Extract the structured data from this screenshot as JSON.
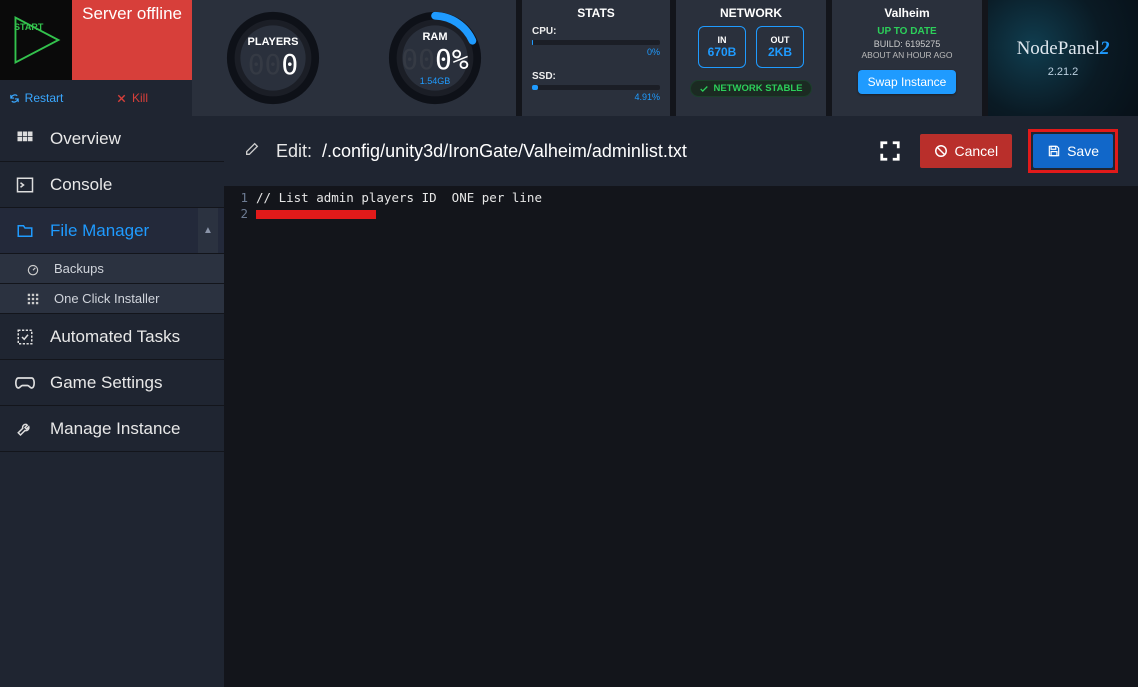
{
  "start": {
    "label": "START"
  },
  "status": {
    "banner": "Server offline",
    "restart": "Restart",
    "kill": "Kill"
  },
  "gauges": {
    "players": {
      "title": "PLAYERS",
      "value": "0",
      "ghost": "00"
    },
    "ram": {
      "title": "RAM",
      "value": "0%",
      "sub": "1.54GB",
      "fill_deg": 55
    }
  },
  "stats": {
    "header": "STATS",
    "cpu": {
      "label": "CPU:",
      "value": "0%",
      "pct": 1
    },
    "ssd": {
      "label": "SSD:",
      "value": "4.91%",
      "pct": 5
    }
  },
  "network": {
    "header": "NETWORK",
    "in": {
      "label": "IN",
      "value": "670B"
    },
    "out": {
      "label": "OUT",
      "value": "2KB"
    },
    "status": "NETWORK STABLE"
  },
  "instance": {
    "name": "Valheim",
    "status": "UP TO DATE",
    "build": "BUILD:   6195275",
    "time": "ABOUT AN HOUR AGO",
    "swap": "Swap Instance"
  },
  "brand": {
    "name": "NodePanel",
    "accent": "2",
    "version": "2.21.2"
  },
  "sidebar": {
    "items": [
      {
        "label": "Overview"
      },
      {
        "label": "Console"
      },
      {
        "label": "File Manager"
      },
      {
        "label": "Automated Tasks"
      },
      {
        "label": "Game Settings"
      },
      {
        "label": "Manage Instance"
      }
    ],
    "subs": [
      {
        "label": "Backups"
      },
      {
        "label": "One Click Installer"
      }
    ]
  },
  "editor": {
    "title": "Edit:",
    "path": "/.config/unity3d/IronGate/Valheim/adminlist.txt",
    "cancel": "Cancel",
    "save": "Save",
    "lines": [
      "// List admin players ID  ONE per line",
      ""
    ]
  }
}
